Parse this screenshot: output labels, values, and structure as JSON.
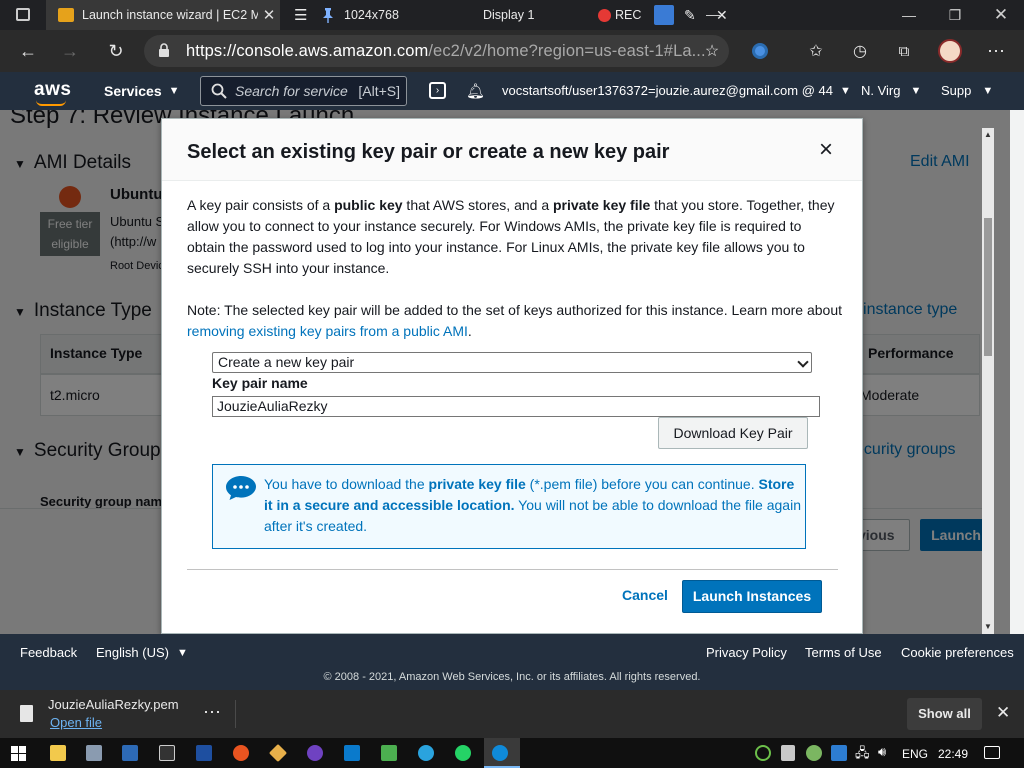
{
  "titlebar": {
    "tab_title": "Launch instance wizard | EC2 Ma",
    "resolution": "1024x768",
    "display": "Display 1",
    "rec": "REC"
  },
  "addressbar": {
    "url_host": "https://console.aws.amazon.com",
    "url_path": "/ec2/v2/home?region=us-east-1#La..."
  },
  "aws_header": {
    "logo": "aws",
    "services": "Services",
    "search_placeholder": "Search for service",
    "search_hint": "[Alt+S]",
    "account": "vocstartsoft/user1376372=jouzie.aurez@gmail.com @ 44",
    "region": "N. Virg",
    "support": "Supp"
  },
  "background_page": {
    "step_title": "Step 7: Review Instance Launch",
    "ami_details": "AMI Details",
    "edit_ami": "Edit AMI",
    "ami_name": "Ubuntu",
    "free_tier": "Free tier",
    "eligible": "eligible",
    "ami_desc1": "Ubuntu S",
    "ami_desc2": "(http://w",
    "root_device": "Root Devic",
    "instance_type_title": "Instance Type",
    "edit_instance_type": "Edit instance type",
    "col_instance_type": "Instance Type",
    "col_performance": "Performance",
    "row_type": "t2.micro",
    "row_perf": "Moderate",
    "security_groups_title": "Security Groups",
    "edit_security_groups": "Edit security groups",
    "security_group_name": "Security group name",
    "previous": "Previous",
    "launch": "Launch"
  },
  "modal": {
    "title": "Select an existing key pair or create a new key pair",
    "close": "×",
    "para1_a": "A key pair consists of a ",
    "para1_b": "public key",
    "para1_c": " that AWS stores, and a ",
    "para1_d": "private key file",
    "para1_e": " that you store. Together, they allow you to connect to your instance securely. For Windows AMIs, the private key file is required to obtain the password used to log into your instance. For Linux AMIs, the private key file allows you to securely SSH into your instance.",
    "note_a": "Note: The selected key pair will be added to the set of keys authorized for this instance. Learn more about ",
    "note_link": "removing existing key pairs from a public AMI",
    "note_end": ".",
    "select_value": "Create a new key pair",
    "key_pair_label": "Key pair name",
    "key_pair_value": "JouzieAuliaRezky",
    "download_button": "Download Key Pair",
    "alert_a": "You have to download the ",
    "alert_b": "private key file",
    "alert_c": " (*.pem file) before you can continue. ",
    "alert_d": "Store it in a secure and accessible location.",
    "alert_e": " You will not be able to download the file again after it's created.",
    "cancel": "Cancel",
    "launch_instances": "Launch Instances"
  },
  "footer": {
    "feedback": "Feedback",
    "language": "English (US)",
    "privacy": "Privacy Policy",
    "terms": "Terms of Use",
    "cookies": "Cookie preferences",
    "copyright": "© 2008 - 2021, Amazon Web Services, Inc. or its affiliates. All rights reserved."
  },
  "download_shelf": {
    "file_name": "JouzieAuliaRezky.pem",
    "open_file": "Open file",
    "more": "⋯",
    "show_all": "Show all"
  },
  "taskbar": {
    "language": "ENG",
    "time": "22:49"
  },
  "colors": {
    "aws_header": "#232f3e",
    "aws_orange": "#ff9900",
    "primary_blue": "#0073bb"
  }
}
